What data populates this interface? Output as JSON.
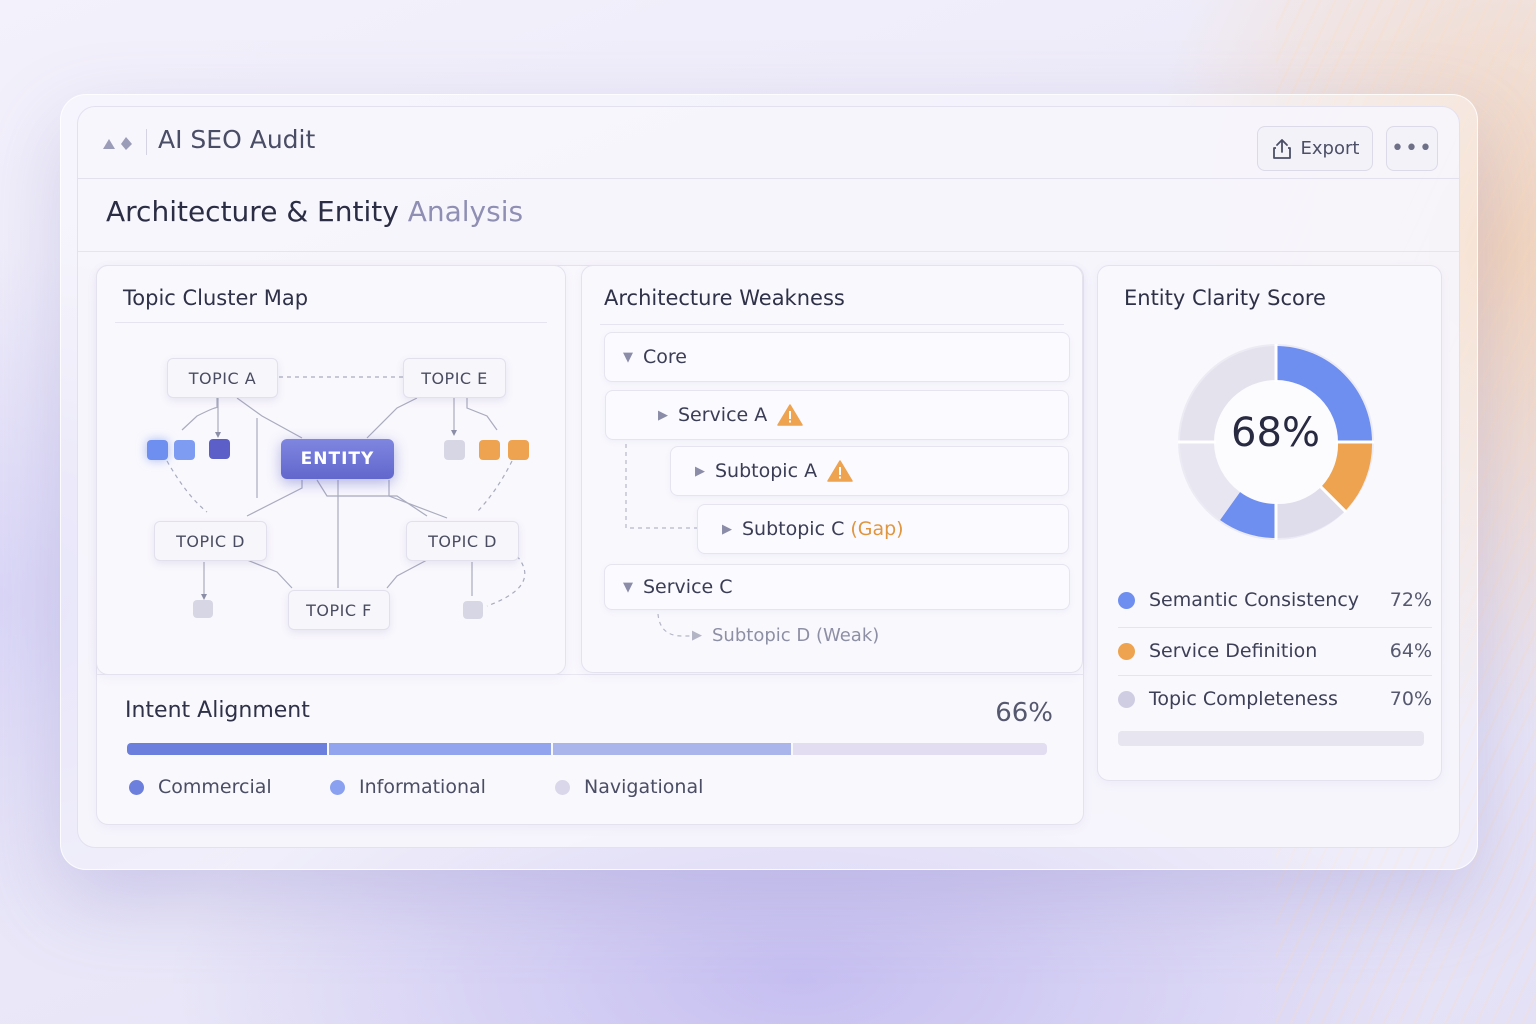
{
  "app": {
    "title": "AI SEO Audit",
    "export_label": "Export",
    "more_label": "•••"
  },
  "page": {
    "title_main": "Architecture & Entity",
    "title_muted": "Analysis"
  },
  "topic_cluster": {
    "title": "Topic Cluster Map",
    "entity_label": "ENTITY",
    "nodes": {
      "topic_a": "TOPIC A",
      "topic_e": "TOPIC E",
      "topic_d_left": "TOPIC D",
      "topic_d_right": "TOPIC D",
      "topic_f": "TOPIC F"
    },
    "colors": {
      "blue": "#6f8ff0",
      "indigo": "#5b5fc7",
      "orange": "#eda350",
      "gray": "#d7d6e4"
    }
  },
  "architecture": {
    "title": "Architecture Weakness",
    "items": {
      "core": "Core",
      "service_a": "Service A",
      "subtopic_a": "Subtopic A",
      "subtopic_c": "Subtopic C",
      "subtopic_c_flag": "(Gap)",
      "service_c": "Service C",
      "subtopic_d": "Subtopic D (Weak)"
    }
  },
  "entity_clarity": {
    "title": "Entity Clarity Score",
    "score": "68%",
    "metrics": [
      {
        "label": "Semantic Consistency",
        "value": "72%",
        "color": "#6f8ff0"
      },
      {
        "label": "Service Definition",
        "value": "64%",
        "color": "#eda350"
      },
      {
        "label": "Topic Completeness",
        "value": "70%",
        "color": "#cfcde2"
      }
    ]
  },
  "intent": {
    "title": "Intent Alignment",
    "score": "66%",
    "legend": [
      {
        "label": "Commercial",
        "color": "#6d7fdc"
      },
      {
        "label": "Informational",
        "color": "#8aa0f0"
      },
      {
        "label": "Navigational",
        "color": "#dad7ea"
      }
    ]
  }
}
